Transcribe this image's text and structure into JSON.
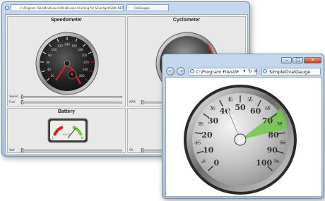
{
  "window1": {
    "address": "C:\\Program Files\\MindFusion\\MindFusion.Charting for Silverlight\\SDK\\.NET 4\\Samp",
    "tab": "CarGauges",
    "panels": {
      "speedometer": {
        "title": "Speedometer"
      },
      "cyclometer": {
        "title": "Cyclometer"
      },
      "battery": {
        "title": "Battery"
      }
    },
    "sliders": {
      "speed": "Speed",
      "fuel": "Fuel",
      "rpm": "RPM",
      "volt": "Volt",
      "oil": "Oil"
    },
    "speedometer_ticks": [
      "20",
      "40",
      "60",
      "80",
      "100",
      "120",
      "140",
      "160",
      "180",
      "200",
      "220",
      "240",
      "260"
    ],
    "battery_labels": {
      "left": "L",
      "right": "H",
      "unit": "VOLTS"
    }
  },
  "window2": {
    "address": "C:\\Program Files\\N",
    "tab": "SimpleOvalGauge",
    "gauge": {
      "ticks": [
        "0",
        "5",
        "10",
        "15",
        "20",
        "25",
        "30",
        "35",
        "40",
        "45",
        "50",
        "55",
        "60",
        "65",
        "70",
        "75",
        "80",
        "85",
        "90",
        "95",
        "100"
      ],
      "major_labels": [
        "0",
        "10",
        "20",
        "30",
        "40",
        "50",
        "60",
        "70",
        "80",
        "90",
        "100"
      ],
      "needle_value": 45
    }
  },
  "colors": {
    "accent_red": "#d62020",
    "range_green": "#6fc84a",
    "chrome": "#a8c2dc"
  }
}
